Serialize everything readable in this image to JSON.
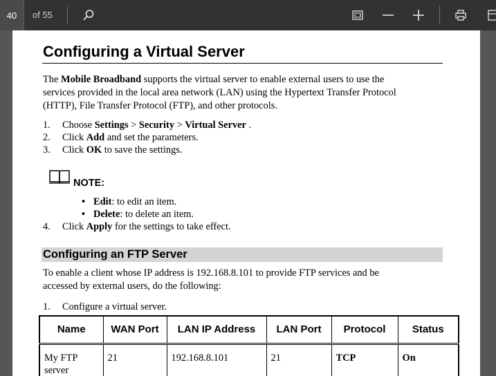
{
  "toolbar": {
    "current_page": "40",
    "page_count": "of 55"
  },
  "document": {
    "title": "Configuring a Virtual Server",
    "intro_pre": "The ",
    "intro_bold": "Mobile Broadband",
    "intro_line1_rest": " supports the virtual server to enable external users to use the",
    "intro_line2": "services provided in the local area network (LAN) using the Hypertext Transfer Protocol",
    "intro_line3": "(HTTP), File Transfer Protocol (FTP), and other protocols.",
    "step1": {
      "num": "1.",
      "pre": "Choose ",
      "b1": "Settings",
      "mid1": " > ",
      "b2": "Security",
      "mid2": " > ",
      "b3": "Virtual Server",
      "post": " ."
    },
    "step2": {
      "num": "2.",
      "pre": "Click ",
      "bold": "Add",
      "post": " and set the parameters."
    },
    "step3": {
      "num": "3.",
      "pre": "Click ",
      "bold": "OK",
      "post": " to save the settings."
    },
    "note_label": "NOTE:",
    "bullet1": {
      "bold": "Edit",
      "post": ": to edit an item."
    },
    "bullet2": {
      "bold": "Delete",
      "post": ": to delete an item."
    },
    "step4": {
      "num": "4.",
      "pre": "Click ",
      "bold": "Apply",
      "post": " for the settings to take effect."
    },
    "section_title": "Configuring an FTP Server",
    "ftp_line1": "To enable a client whose IP address is 192.168.8.101 to provide FTP services and be",
    "ftp_line2": "accessed by external users, do the following:",
    "ftp_step1": {
      "num": "1.",
      "text": "Configure a virtual server."
    },
    "table": {
      "headers": [
        "Name",
        "WAN Port",
        "LAN IP Address",
        "LAN Port",
        "Protocol",
        "Status"
      ],
      "row": [
        "My FTP server",
        "21",
        "192.168.8.101",
        "21",
        "TCP",
        "On"
      ]
    }
  }
}
